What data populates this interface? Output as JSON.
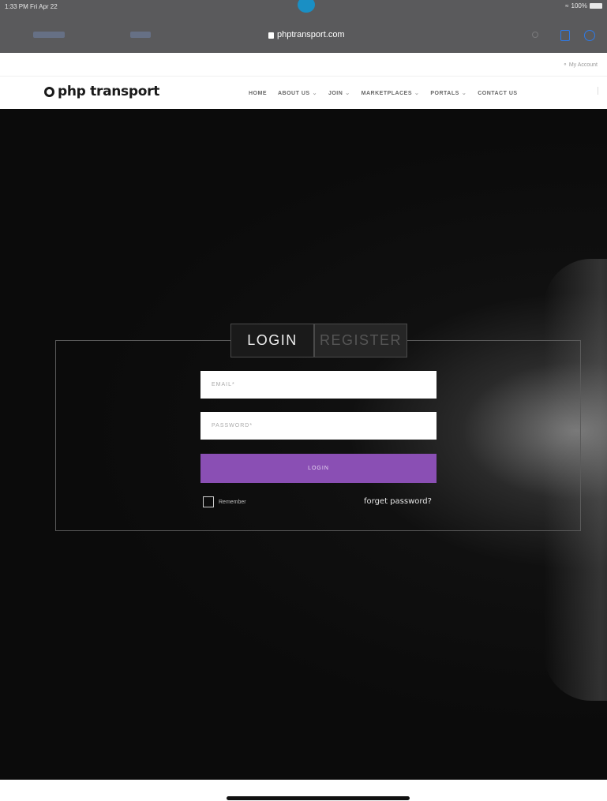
{
  "status_bar": {
    "time": "1:33 PM  Fri Apr 22",
    "battery": "100%"
  },
  "browser": {
    "url": "phptransport.com"
  },
  "account": {
    "link": "My Account"
  },
  "brand": {
    "name": "php transport",
    "accent": "#8a4fb4",
    "link_blue": "#2e7ae6"
  },
  "nav": {
    "items": [
      {
        "label": "HOME",
        "dropdown": false
      },
      {
        "label": "ABOUT US",
        "dropdown": true
      },
      {
        "label": "JOIN",
        "dropdown": true
      },
      {
        "label": "MARKETPLACES",
        "dropdown": true
      },
      {
        "label": "PORTALS",
        "dropdown": true
      },
      {
        "label": "CONTACT US",
        "dropdown": false
      }
    ]
  },
  "auth": {
    "tabs": {
      "login": "LOGIN",
      "register": "REGISTER",
      "active": "login"
    },
    "email_placeholder": "EMAIL*",
    "password_placeholder": "PASSWORD*",
    "submit_label": "LOGIN",
    "remember_label": "Remember",
    "remember_checked": false,
    "forgot_label": "forget password?"
  }
}
